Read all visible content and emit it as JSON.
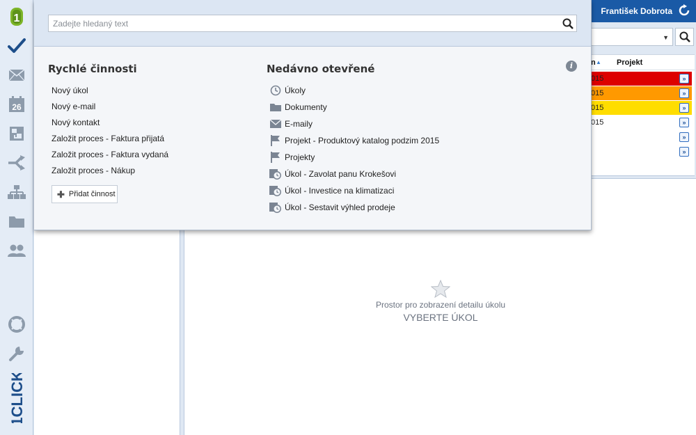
{
  "app": {
    "user_name": "František Dobrota",
    "brand_vertical": "1CLICK"
  },
  "sidebar": {
    "items": [
      {
        "icon": "app-logo-icon"
      },
      {
        "icon": "tasks-check-icon"
      },
      {
        "icon": "mail-icon"
      },
      {
        "icon": "calendar-icon",
        "label": "26"
      },
      {
        "icon": "documents-icon"
      },
      {
        "icon": "processes-icon"
      },
      {
        "icon": "org-chart-icon"
      },
      {
        "icon": "folder-icon"
      },
      {
        "icon": "contacts-icon"
      },
      {
        "icon": "help-lifebuoy-icon"
      },
      {
        "icon": "settings-wrench-icon"
      }
    ]
  },
  "search": {
    "placeholder": "Zadejte hledaný text",
    "value": ""
  },
  "quick_actions": {
    "title": "Rychlé činnosti",
    "items": [
      "Nový úkol",
      "Nový e-mail",
      "Nový kontakt",
      "Založit proces - Faktura přijatá",
      "Založit proces - Faktura vydaná",
      "Založit proces - Nákup"
    ],
    "add_label": "Přidat činnost"
  },
  "recent": {
    "title": "Nedávno otevřené",
    "items": [
      {
        "icon": "clock-icon",
        "label": "Úkoly"
      },
      {
        "icon": "folder-icon",
        "label": "Dokumenty"
      },
      {
        "icon": "mail-icon",
        "label": "E-maily"
      },
      {
        "icon": "flag-icon",
        "label": "Projekt - Produktový katalog podzim 2015"
      },
      {
        "icon": "flag-icon",
        "label": "Projekty"
      },
      {
        "icon": "task-clock-icon",
        "label": "Úkol - Zavolat panu Krokešovi"
      },
      {
        "icon": "task-clock-icon",
        "label": "Úkol - Investice na klimatizaci"
      },
      {
        "icon": "task-clock-icon",
        "label": "Úkol - Sestavit výhled prodeje"
      }
    ]
  },
  "grid": {
    "header_col_a": "n",
    "header_col_b": "Projekt",
    "rows": [
      {
        "cell": "015",
        "color": "#dd0000"
      },
      {
        "cell": "015",
        "color": "#ff9900"
      },
      {
        "cell": "015",
        "color": "#ffdd00"
      },
      {
        "cell": "015",
        "color": "#ffffff"
      },
      {
        "cell": "",
        "color": "#ffffff"
      },
      {
        "cell": "",
        "color": "#ffffff"
      }
    ]
  },
  "detail": {
    "hint": "Prostor pro zobrazení detailu úkolu",
    "cta": "VYBERTE ÚKOL"
  },
  "colors": {
    "topbar": "#1a5aa6",
    "accent_green": "#6ca21f",
    "icon_gray": "#8d9bab"
  }
}
